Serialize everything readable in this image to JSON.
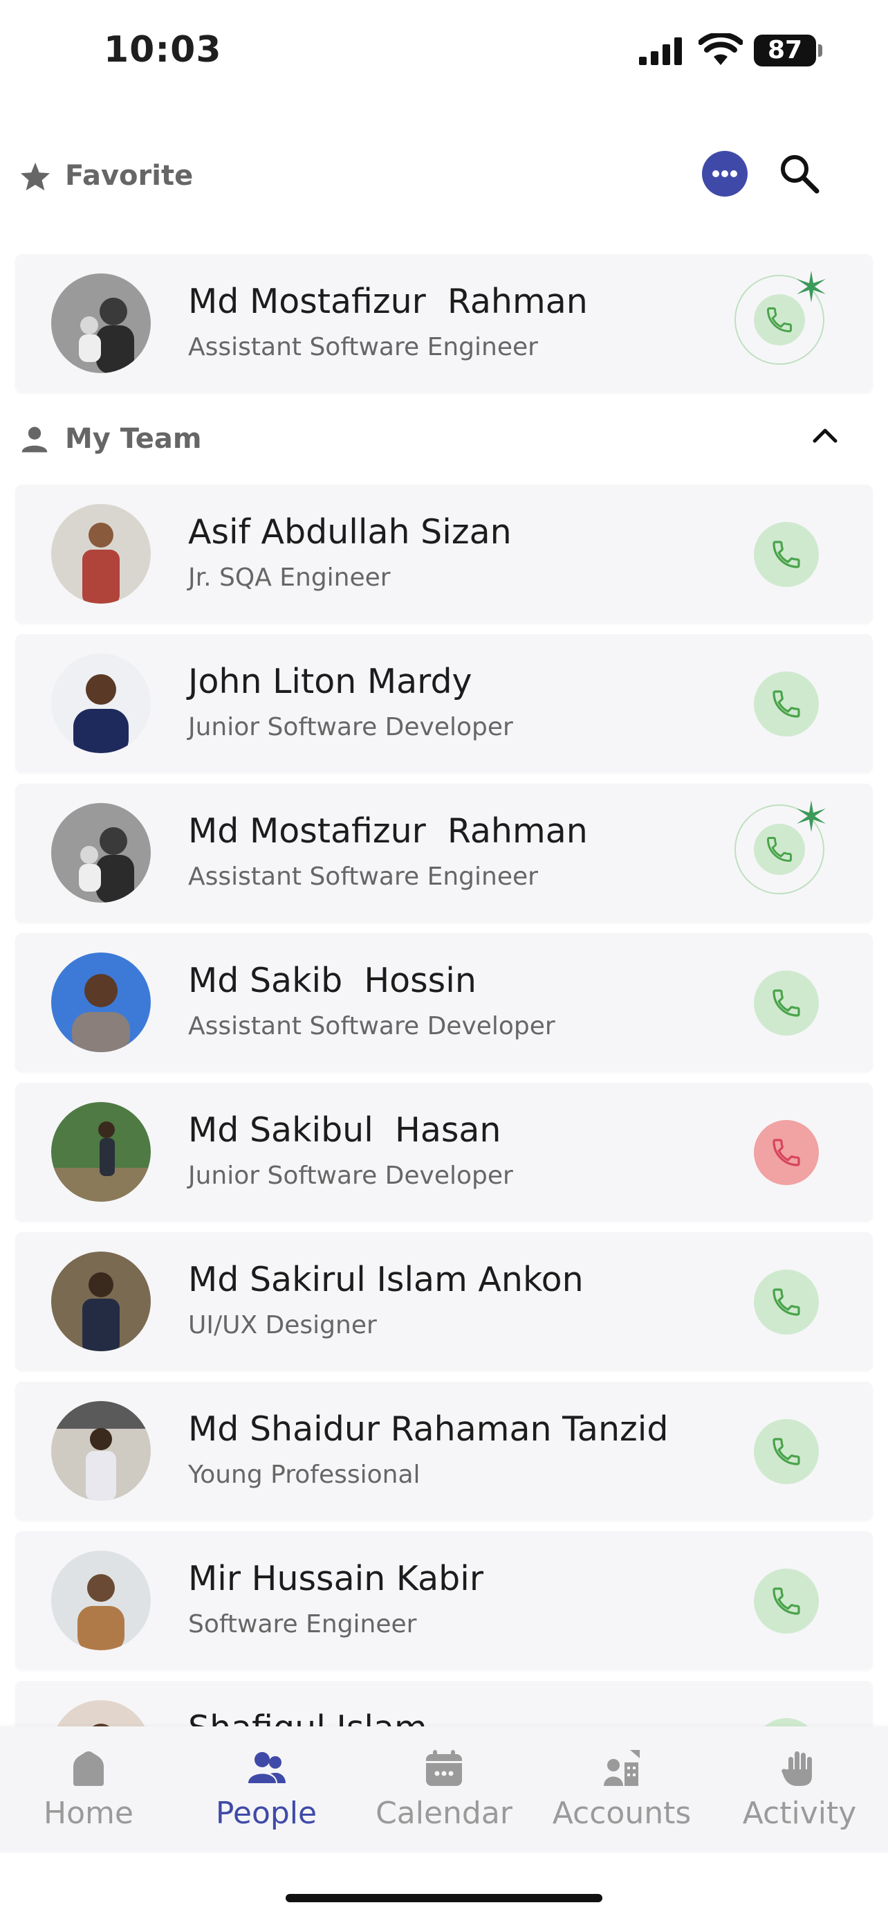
{
  "status_bar": {
    "time": "10:03",
    "battery": "87"
  },
  "favorite": {
    "title": "Favorite",
    "people": [
      {
        "name": "Md Mostafizur  Rahman",
        "role": "Assistant Software Engineer",
        "call_state": "active"
      }
    ]
  },
  "team": {
    "title": "My Team",
    "people": [
      {
        "name": "Asif Abdullah Sizan",
        "role": "Jr. SQA Engineer",
        "call_state": "available"
      },
      {
        "name": "John Liton Mardy",
        "role": "Junior Software Developer",
        "call_state": "available"
      },
      {
        "name": "Md Mostafizur  Rahman",
        "role": "Assistant Software Engineer",
        "call_state": "active"
      },
      {
        "name": "Md Sakib  Hossin",
        "role": "Assistant Software Developer",
        "call_state": "available"
      },
      {
        "name": "Md Sakibul  Hasan",
        "role": "Junior Software Developer",
        "call_state": "busy"
      },
      {
        "name": "Md Sakirul Islam Ankon",
        "role": "UI/UX Designer",
        "call_state": "available"
      },
      {
        "name": "Md Shaidur Rahaman Tanzid",
        "role": "Young Professional",
        "call_state": "available"
      },
      {
        "name": "Mir Hussain Kabir",
        "role": "Software Engineer",
        "call_state": "available"
      },
      {
        "name": "Shafiqul Islam",
        "role": "",
        "call_state": "available"
      }
    ]
  },
  "tabs": [
    {
      "label": "Home",
      "icon": "home-icon",
      "active": false
    },
    {
      "label": "People",
      "icon": "people-icon",
      "active": true
    },
    {
      "label": "Calendar",
      "icon": "calendar-icon",
      "active": false
    },
    {
      "label": "Accounts",
      "icon": "accounts-icon",
      "active": false
    },
    {
      "label": "Activity",
      "icon": "hand-icon",
      "active": false
    }
  ],
  "colors": {
    "accent": "#3f4aa8",
    "call_green": "#cfe9cf",
    "call_red": "#f1a2a2"
  }
}
